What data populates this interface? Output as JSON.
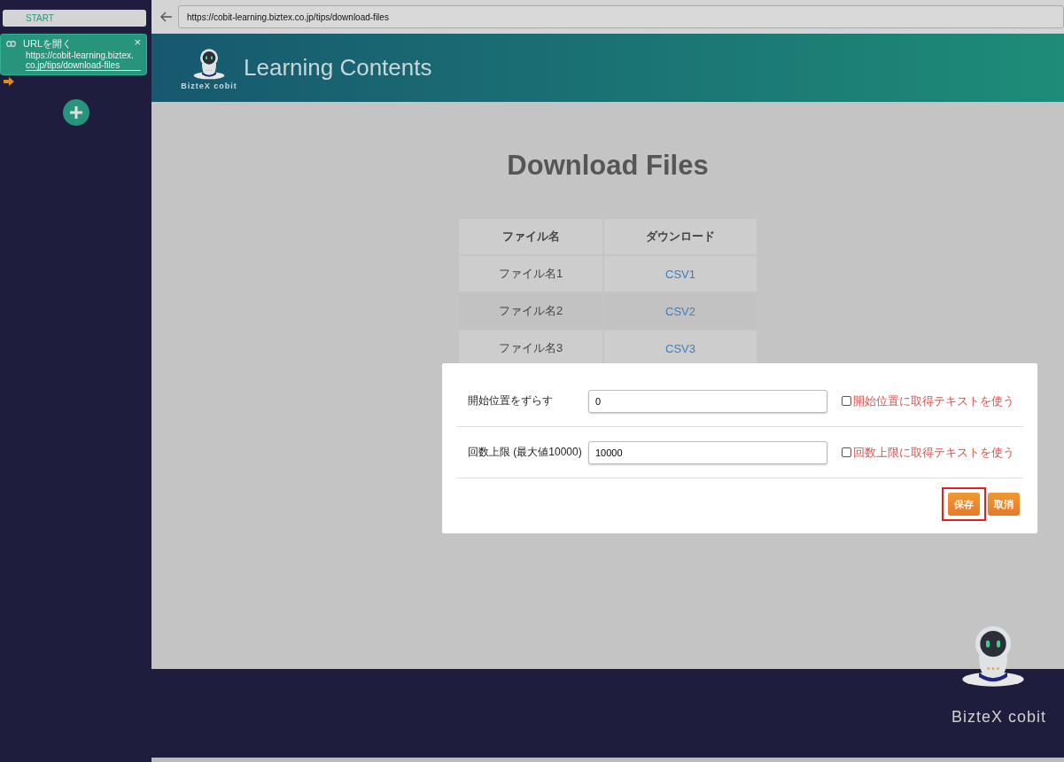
{
  "sidebar": {
    "start_label": "START",
    "steps": [
      {
        "title": "URLを開く",
        "url": "https://cobit-learning.biztex.co.jp/tips/download-files",
        "close": "×",
        "selected": true
      }
    ]
  },
  "browser": {
    "url": "https://cobit-learning.biztex.co.jp/tips/download-files"
  },
  "page": {
    "logo_text": "BizteX cobit",
    "header_title": "Learning Contents",
    "heading": "Download Files",
    "table": {
      "columns": [
        "ファイル名",
        "ダウンロード"
      ],
      "rows": [
        [
          "ファイル名1",
          "CSV1"
        ],
        [
          "ファイル名2",
          "CSV2"
        ],
        [
          "ファイル名3",
          "CSV3"
        ]
      ]
    },
    "footer_logo_text": "BizteX cobit"
  },
  "dialog": {
    "fields": [
      {
        "label": "開始位置をずらす",
        "value": "0",
        "option": "開始位置に取得テキストを使う",
        "checked": false
      },
      {
        "label": "回数上限 (最大値10000)",
        "value": "10000",
        "option": "回数上限に取得テキストを使う",
        "checked": false
      }
    ],
    "buttons": [
      {
        "label": "保存",
        "highlighted": true
      },
      {
        "label": "取消",
        "highlighted": false
      }
    ]
  }
}
